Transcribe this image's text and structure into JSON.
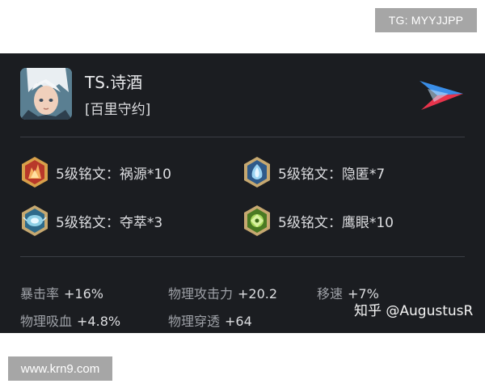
{
  "watermarks": {
    "top": "TG: MYYJJPP",
    "bottom": "www.krn9.com"
  },
  "player": {
    "name": "TS.诗酒",
    "hero": "[百里守约]"
  },
  "runes": [
    {
      "label": "5级铭文：祸源*10",
      "icon": "rune-red-icon",
      "color": "#c8462c"
    },
    {
      "label": "5级铭文：隐匿*7",
      "icon": "rune-blue-icon",
      "color": "#4a8fc4"
    },
    {
      "label": "5级铭文：夺萃*3",
      "icon": "rune-blue-icon",
      "color": "#4aa3c0"
    },
    {
      "label": "5级铭文：鹰眼*10",
      "icon": "rune-green-icon",
      "color": "#7fb53a"
    }
  ],
  "stats": [
    {
      "label": "暴击率",
      "value": "+16%"
    },
    {
      "label": "物理攻击力",
      "value": "+20.2"
    },
    {
      "label": "移速",
      "value": "+7%"
    },
    {
      "label": "物理吸血",
      "value": "+4.8%"
    },
    {
      "label": "物理穿透",
      "value": "+64"
    }
  ],
  "credit": "知乎 @AugustusR",
  "colors": {
    "card_background": "#1b1d21",
    "watermark": "#a6a6a6"
  }
}
